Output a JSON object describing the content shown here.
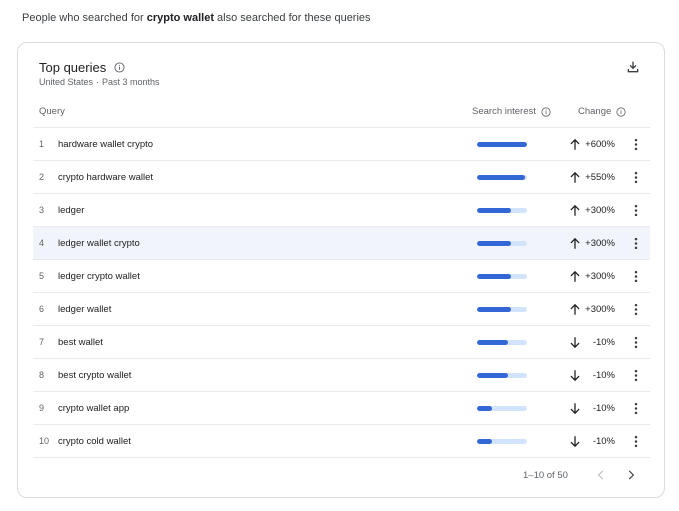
{
  "intro": {
    "prefix": "People who searched for ",
    "term": "crypto wallet",
    "suffix": " also searched for these queries"
  },
  "card": {
    "title": "Top queries",
    "region": "United States",
    "separator": "·",
    "period": "Past 3 months"
  },
  "table": {
    "col_query": "Query",
    "col_interest": "Search interest",
    "col_change": "Change",
    "rows": [
      {
        "rank": "1",
        "query": "hardware wallet crypto",
        "interest": 100,
        "direction": "up",
        "change": "+600%"
      },
      {
        "rank": "2",
        "query": "crypto hardware wallet",
        "interest": 95,
        "direction": "up",
        "change": "+550%"
      },
      {
        "rank": "3",
        "query": "ledger",
        "interest": 68,
        "direction": "up",
        "change": "+300%"
      },
      {
        "rank": "4",
        "query": "ledger wallet crypto",
        "interest": 68,
        "direction": "up",
        "change": "+300%"
      },
      {
        "rank": "5",
        "query": "ledger crypto wallet",
        "interest": 68,
        "direction": "up",
        "change": "+300%"
      },
      {
        "rank": "6",
        "query": "ledger wallet",
        "interest": 68,
        "direction": "up",
        "change": "+300%"
      },
      {
        "rank": "7",
        "query": "best wallet",
        "interest": 62,
        "direction": "down",
        "change": "-10%"
      },
      {
        "rank": "8",
        "query": "best crypto wallet",
        "interest": 62,
        "direction": "down",
        "change": "-10%"
      },
      {
        "rank": "9",
        "query": "crypto wallet app",
        "interest": 30,
        "direction": "down",
        "change": "-10%"
      },
      {
        "rank": "10",
        "query": "crypto cold wallet",
        "interest": 30,
        "direction": "down",
        "change": "-10%"
      }
    ]
  },
  "pager": {
    "range": "1–10 of 50"
  },
  "colors": {
    "bar_fill": "#3367d6",
    "bar_track": "#d2e3fc",
    "highlight_row": "#f1f5fb"
  },
  "icons": {
    "info": "info-icon",
    "download": "download-icon",
    "up": "arrow-up-icon",
    "down": "arrow-down-icon",
    "more": "more-vert-icon",
    "prev": "chevron-left-icon",
    "next": "chevron-right-icon"
  }
}
